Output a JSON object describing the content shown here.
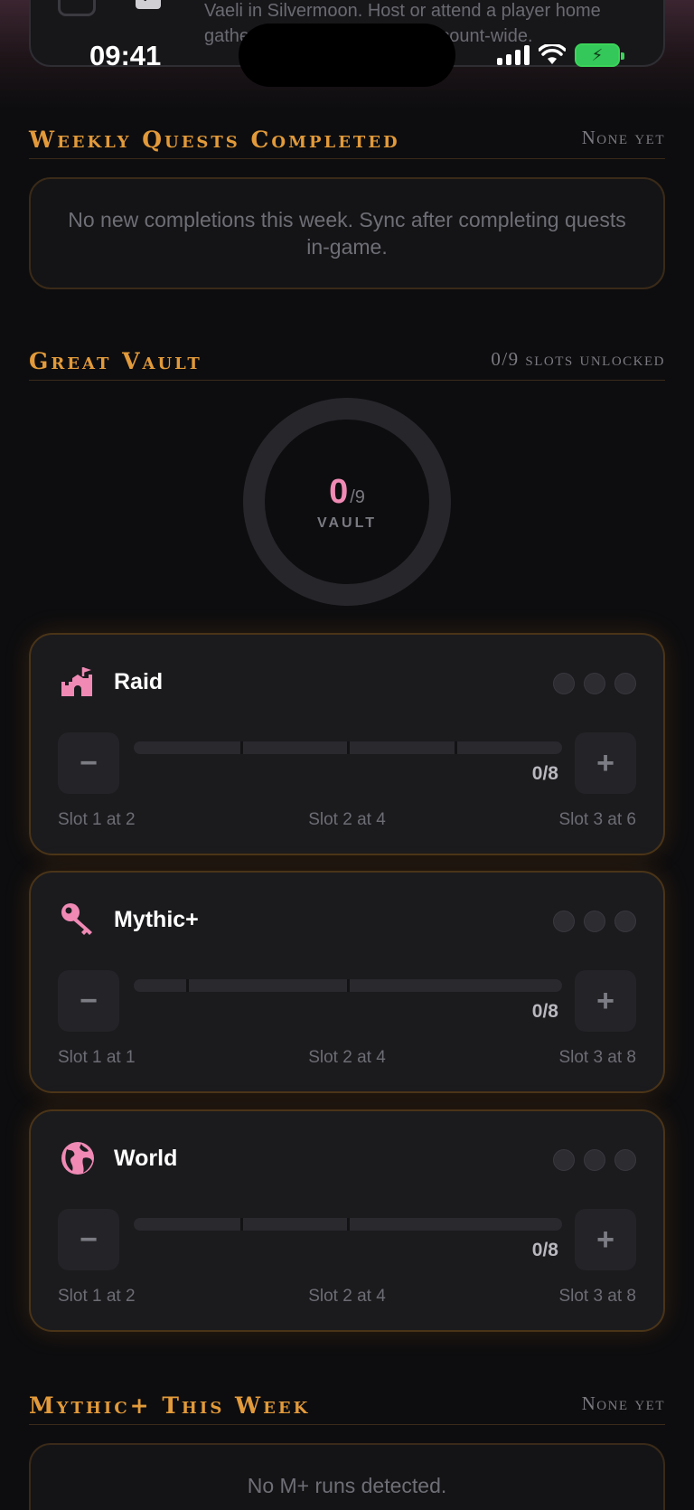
{
  "status_bar": {
    "time": "09:41"
  },
  "previous_card": {
    "text": "Vaeli in Silvermoon. Host or attend a player home gathering. Quest reward is account-wide."
  },
  "weekly_quests": {
    "title": "Weekly Quests Completed",
    "meta": "None yet",
    "empty_message": "No new completions this week. Sync after completing quests in-game."
  },
  "great_vault": {
    "title": "Great Vault",
    "meta": "0/9 slots unlocked",
    "ring": {
      "count": "0",
      "total": "/9",
      "label": "VAULT"
    },
    "activities": [
      {
        "name": "Raid",
        "icon": "castle-icon",
        "progress": "0/8",
        "progress_value": 0,
        "max": 8,
        "thresholds": [
          2,
          4,
          6
        ],
        "slot_labels": [
          "Slot 1 at 2",
          "Slot 2 at 4",
          "Slot 3 at 6"
        ]
      },
      {
        "name": "Mythic+",
        "icon": "key-icon",
        "progress": "0/8",
        "progress_value": 0,
        "max": 8,
        "thresholds": [
          1,
          4,
          8
        ],
        "slot_labels": [
          "Slot 1 at 1",
          "Slot 2 at 4",
          "Slot 3 at 8"
        ]
      },
      {
        "name": "World",
        "icon": "globe-icon",
        "progress": "0/8",
        "progress_value": 0,
        "max": 8,
        "thresholds": [
          2,
          4,
          8
        ],
        "slot_labels": [
          "Slot 1 at 2",
          "Slot 2 at 4",
          "Slot 3 at 8"
        ]
      }
    ],
    "minus_label": "−",
    "plus_label": "+"
  },
  "mythic_plus": {
    "title": "Mythic+ This Week",
    "meta": "None yet",
    "empty_message": "No M+ runs detected."
  },
  "colors": {
    "accent": "#e29a3a",
    "pink": "#f08ab5",
    "battery": "#34c759"
  }
}
